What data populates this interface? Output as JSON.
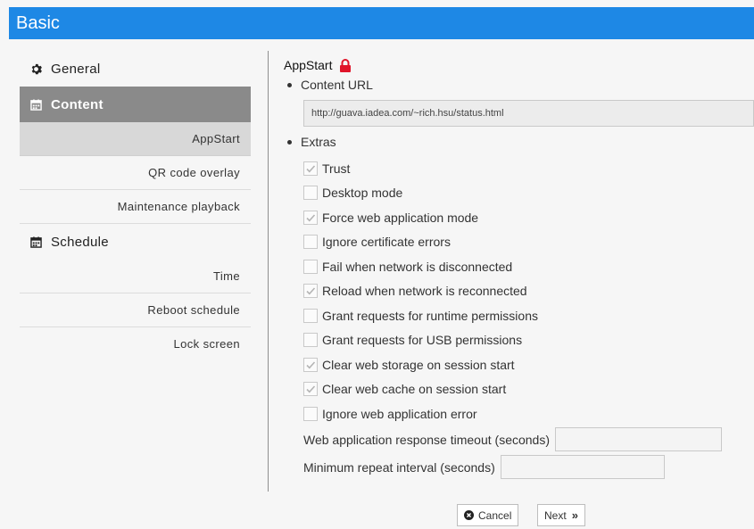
{
  "window": {
    "title": "Basic"
  },
  "sidebar": {
    "sections": [
      {
        "label": "General",
        "icon": "gear-icon"
      },
      {
        "label": "Content",
        "icon": "calendar-icon",
        "items": [
          "AppStart",
          "QR code overlay",
          "Maintenance playback"
        ]
      },
      {
        "label": "Schedule",
        "icon": "calendar-icon",
        "items": [
          "Time",
          "Reboot schedule",
          "Lock screen"
        ]
      }
    ],
    "active_section": "Content",
    "active_item": "AppStart"
  },
  "main": {
    "heading": "AppStart",
    "content_url": {
      "label": "Content URL",
      "value": "http://guava.iadea.com/~rich.hsu/status.html"
    },
    "extras": {
      "label": "Extras",
      "options": [
        {
          "label": "Trust",
          "checked": true
        },
        {
          "label": "Desktop mode",
          "checked": false
        },
        {
          "label": "Force web application mode",
          "checked": true
        },
        {
          "label": "Ignore certificate errors",
          "checked": false
        },
        {
          "label": "Fail when network is disconnected",
          "checked": false
        },
        {
          "label": "Reload when network is reconnected",
          "checked": true
        },
        {
          "label": "Grant requests for runtime permissions",
          "checked": false
        },
        {
          "label": "Grant requests for USB permissions",
          "checked": false
        },
        {
          "label": "Clear web storage on session start",
          "checked": true
        },
        {
          "label": "Clear web cache on session start",
          "checked": true
        },
        {
          "label": "Ignore web application error",
          "checked": false
        }
      ]
    },
    "timeout": {
      "label": "Web application response timeout (seconds)",
      "value": ""
    },
    "repeat": {
      "label": "Minimum repeat interval (seconds)",
      "value": ""
    }
  },
  "footer": {
    "cancel_label": "Cancel",
    "next_label": "Next"
  },
  "colors": {
    "titlebar": "#1e88e5",
    "lock": "#e0152a",
    "active_section": "#8a8a8a"
  }
}
